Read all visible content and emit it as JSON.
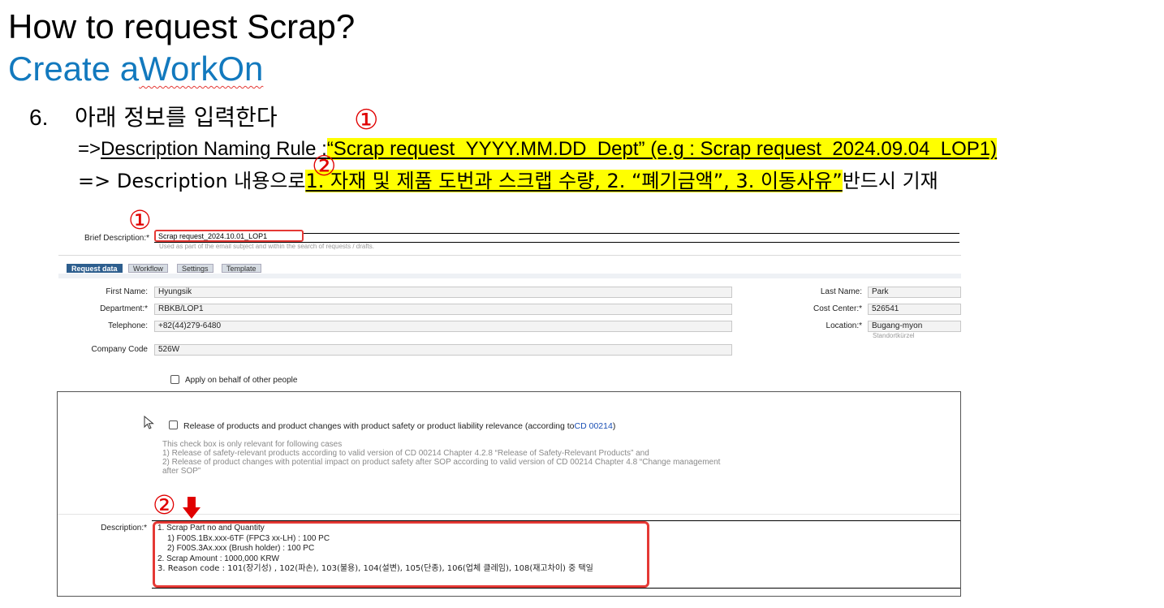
{
  "slide": {
    "title": "How to request Scrap?",
    "subtitle_prefix": "Create a ",
    "subtitle_word": "WorkOn"
  },
  "step": {
    "number": "6.",
    "text": "아래 정보를 입력한다"
  },
  "rule_line": {
    "prefix": "=> ",
    "label": "Description Naming Rule : ",
    "value": "“Scrap request_YYYY.MM.DD_Dept” (e.g : Scrap request_2024.09.04_LOP1)"
  },
  "content_line": {
    "prefix": "=> Description 내용으로 ",
    "value": "1. 자재 및 제품 도번과 스크랩 수량, 2. “폐기금액”, 3. 이동사유”",
    "suffix": " 반드시 기재"
  },
  "markers": {
    "one": "①",
    "two": "②"
  },
  "form": {
    "brief_label": "Brief Description:*",
    "brief_value": "Scrap request_2024.10.01_LOP1",
    "brief_hint": "Used as part of the email subject and within the search of requests / drafts.",
    "tabs": [
      {
        "label": "Request data"
      },
      {
        "label": "Workflow"
      },
      {
        "label": "Settings"
      },
      {
        "label": "Template"
      }
    ],
    "first_name_label": "First Name:",
    "first_name": "Hyungsik",
    "department_label": "Department:*",
    "department": "RBKB/LOP1",
    "telephone_label": "Telephone:",
    "telephone": "+82(44)279-6480",
    "company_code_label": "Company Code",
    "company_code": "526W",
    "last_name_label": "Last Name:",
    "last_name": "Park",
    "cost_center_label": "Cost Center:*",
    "cost_center": "526541",
    "location_label": "Location:*",
    "location": "Bugang-myon",
    "location_hint": "Standortkürzel",
    "behalf_label": "Apply on behalf of other people",
    "release_label": "Release of products and product changes with product safety or product liability relevance (according to ",
    "release_link": "CD 00214",
    "release_close": ")",
    "release_notes": [
      "This check box is only relevant for following cases",
      "1) Release of safety-relevant products according to valid version of CD 00214 Chapter 4.2.8 “Release of Safety-Relevant Products” and",
      "2) Release of product changes with potential impact on product safety after SOP according to valid version of CD 00214 Chapter 4.8 “Change management",
      "after SOP”"
    ],
    "description_label": "Description:*",
    "description_lines": [
      "1. Scrap Part no and Quantity",
      "   1) F00S.1Bx.xxx-6TF (FPC3 xx-LH) : 100 PC",
      "   2) F00S.3Ax.xxx (Brush holder) : 100 PC",
      "2. Scrap Amount : 1000,000 KRW",
      "3. Reason code : 101(장기성) , 102(파손), 103(불용), 104(설변), 105(단종), 106(업체 클레임), 108(재고차이) 중 택일"
    ]
  },
  "colors": {
    "accent_blue": "#1279be",
    "highlight": "#ffff00",
    "marker_red": "#e00000",
    "tab_active": "#2d5e8e"
  }
}
